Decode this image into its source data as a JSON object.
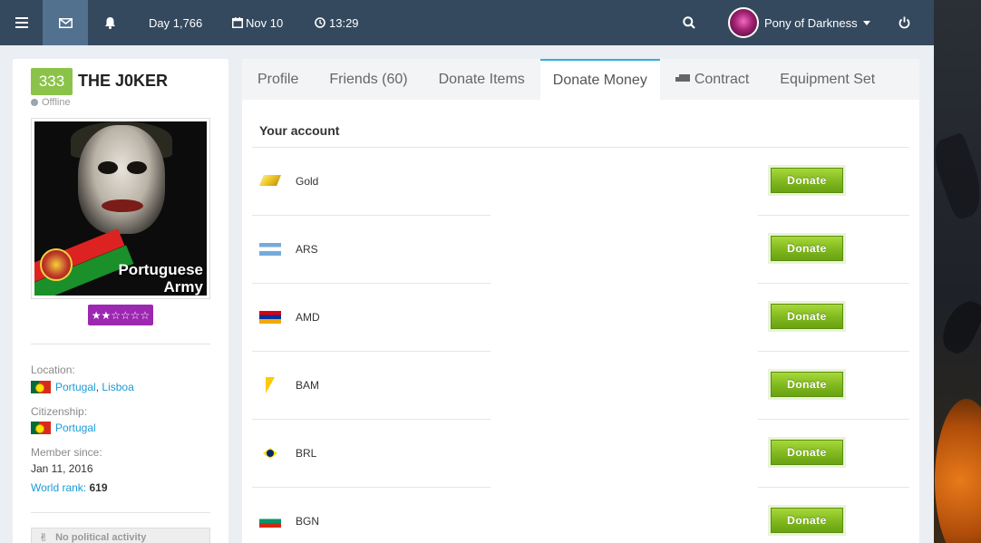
{
  "navbar": {
    "day": "Day 1,766",
    "date": "Nov 10",
    "time": "13:29",
    "username": "Pony of Darkness"
  },
  "profile": {
    "level": "333",
    "name": "THE J0KER",
    "status": "Offline",
    "avatar_caption_line1": "Portuguese",
    "avatar_caption_line2": "Army",
    "stars": "★★☆☆☆☆",
    "location_label": "Location:",
    "location_country": "Portugal",
    "location_sep": ",",
    "location_region": "Lisboa",
    "citizenship_label": "Citizenship:",
    "citizenship_country": "Portugal",
    "member_since_label": "Member since:",
    "member_since_value": "Jan 11, 2016",
    "world_rank_label": "World rank:",
    "world_rank_value": "619",
    "political": "No political activity"
  },
  "tabs": [
    {
      "label": "Profile"
    },
    {
      "label": "Friends (60)"
    },
    {
      "label": "Donate Items"
    },
    {
      "label": "Donate Money"
    },
    {
      "label": "Contract"
    },
    {
      "label": "Equipment Set"
    }
  ],
  "account": {
    "title": "Your account",
    "donate_label": "Donate",
    "rows": [
      {
        "name": "Gold",
        "icon": "gold-bar-icon"
      },
      {
        "name": "ARS",
        "icon": "argentina-flag-icon"
      },
      {
        "name": "AMD",
        "icon": "armenia-flag-icon"
      },
      {
        "name": "BAM",
        "icon": "bosnia-flag-icon"
      },
      {
        "name": "BRL",
        "icon": "brazil-flag-icon"
      },
      {
        "name": "BGN",
        "icon": "bulgaria-flag-icon"
      }
    ]
  },
  "colors": {
    "navbar": "#34495e",
    "accent": "#2cb0d9",
    "level_badge": "#8bc34a",
    "stars_badge": "#9c27b0",
    "donate_button": "#7fb81e",
    "link": "#1a9bd6"
  }
}
